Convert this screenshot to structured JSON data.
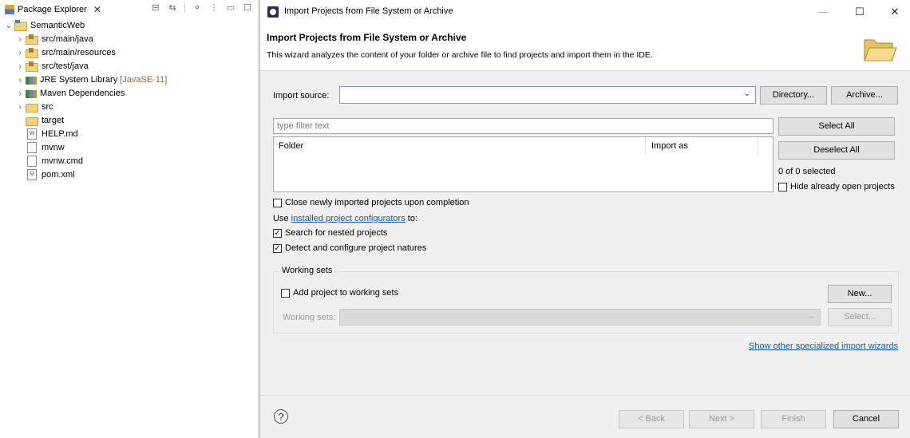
{
  "explorer": {
    "tab_title": "Package Explorer",
    "tab_close": "✕",
    "toolbar": [
      "collapse-all",
      "link-with-editor",
      "focus",
      "view-menu",
      "minimize",
      "maximize"
    ],
    "tree": [
      {
        "label": "SemanticWeb",
        "icon": "project-icon",
        "twisty": "⌄"
      },
      {
        "label": "src/main/java",
        "icon": "source-folder-icon",
        "twisty": "›"
      },
      {
        "label": "src/main/resources",
        "icon": "source-folder-icon",
        "twisty": "›"
      },
      {
        "label": "src/test/java",
        "icon": "source-folder-icon",
        "twisty": "›"
      },
      {
        "label": "JRE System Library",
        "suffix": "[JavaSE-11]",
        "icon": "library-icon",
        "twisty": "›"
      },
      {
        "label": "Maven Dependencies",
        "icon": "library-icon",
        "twisty": "›"
      },
      {
        "label": "src",
        "icon": "folder-icon",
        "twisty": "›"
      },
      {
        "label": "target",
        "icon": "folder-icon"
      },
      {
        "label": "HELP.md",
        "icon": "markdown-file-icon",
        "glyph": "W"
      },
      {
        "label": "mvnw",
        "icon": "text-file-icon",
        "glyph": ""
      },
      {
        "label": "mvnw.cmd",
        "icon": "cmd-file-icon",
        "glyph": ""
      },
      {
        "label": "pom.xml",
        "icon": "maven-file-icon",
        "glyph": "M"
      }
    ]
  },
  "dialog": {
    "window_title": "Import Projects from File System or Archive",
    "controls": {
      "minimize": "—",
      "maximize": "☐",
      "close": "✕"
    },
    "banner": {
      "title": "Import Projects from File System or Archive",
      "description": "This wizard analyzes the content of your folder or archive file to find projects and import them in the IDE."
    },
    "import_source_label": "Import source:",
    "import_source_value": "",
    "directory_button": "Directory...",
    "archive_button": "Archive...",
    "filter_placeholder": "type filter text",
    "select_all_button": "Select All",
    "deselect_all_button": "Deselect All",
    "table_headers": [
      "Folder",
      "Import as"
    ],
    "selected_count": "0 of 0 selected",
    "hide_open_label": "Hide already open projects",
    "close_imported_label": "Close newly imported projects upon completion",
    "configurators_prefix": "Use ",
    "configurators_link": "installed project configurators",
    "configurators_suffix": " to:",
    "search_nested_label": "Search for nested projects",
    "detect_natures_label": "Detect and configure project natures",
    "working_sets_group": "Working sets",
    "add_to_ws_label": "Add project to working sets",
    "new_button": "New...",
    "working_sets_label": "Working sets:",
    "select_button": "Select...",
    "other_wizards_link": "Show other specialized import wizards",
    "help_symbol": "?",
    "back_button": "< Back",
    "next_button": "Next >",
    "finish_button": "Finish",
    "cancel_button": "Cancel",
    "checkboxes": {
      "hide_open": false,
      "close_imported": false,
      "search_nested": true,
      "detect_natures": true,
      "add_to_ws": false
    }
  }
}
